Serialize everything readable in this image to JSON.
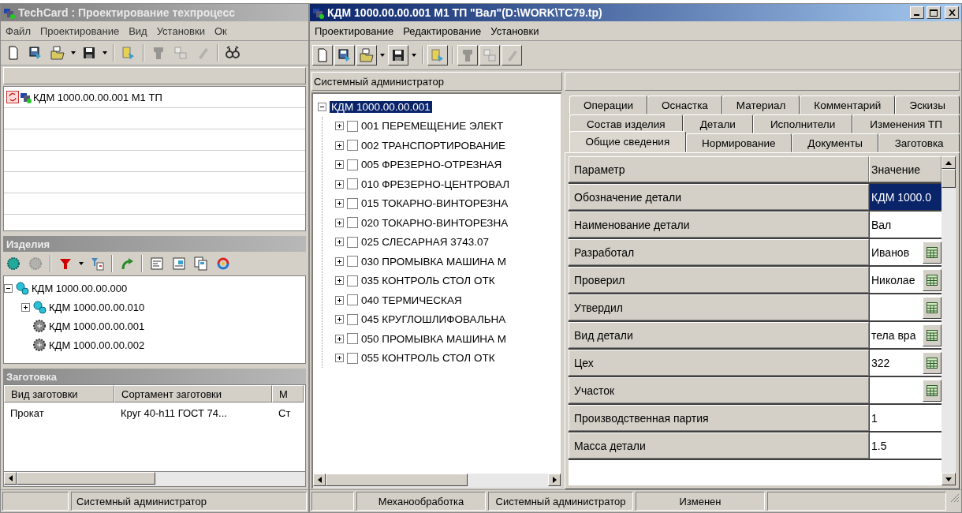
{
  "left_window": {
    "title": "TechCard : Проектирование техпроцесс",
    "menu": [
      "Файл",
      "Проектирование",
      "Вид",
      "Установки",
      "Ок"
    ],
    "documents": [
      {
        "label": "КДМ 1000.00.00.001 М1 ТП"
      }
    ],
    "products_panel": {
      "title": "Изделия",
      "tree": [
        {
          "label": "КДМ 1000.00.00.000",
          "kind": "assembly",
          "expanded": true,
          "children": [
            {
              "label": "КДМ 1000.00.00.010",
              "kind": "assembly",
              "expanded": false
            },
            {
              "label": "КДМ 1000.00.00.001",
              "kind": "part"
            },
            {
              "label": "КДМ 1000.00.00.002",
              "kind": "part"
            }
          ]
        }
      ]
    },
    "blank_panel": {
      "title": "Заготовка",
      "columns": [
        "Вид заготовки",
        "Сортамент заготовки",
        "М"
      ],
      "rows": [
        [
          "Прокат",
          "Круг  40-h11 ГОСТ 74...",
          "Ст"
        ]
      ]
    },
    "status_bar": [
      "Системный администратор"
    ]
  },
  "main_window": {
    "title": "КДМ 1000.00.00.001 М1 ТП \"Вал\"(D:\\WORK\\TC79.tp)",
    "menu": [
      "Проектирование",
      "Редактирование",
      "Установки"
    ],
    "user_field": "Системный администратор",
    "tree": {
      "label": "КДМ 1000.00.00.001",
      "expanded": true,
      "selected": true,
      "children": [
        {
          "label": "001  ПЕРЕМЕЩЕНИЕ   ЭЛЕКТ",
          "checked": false,
          "expanded": false
        },
        {
          "label": "002  ТРАНСПОРТИРОВАНИЕ",
          "checked": false,
          "expanded": false
        },
        {
          "label": "005  ФРЕЗЕРНО-ОТРЕЗНАЯ",
          "checked": false,
          "expanded": false
        },
        {
          "label": "010  ФРЕЗЕРНО-ЦЕНТРОВАЛ",
          "checked": false,
          "expanded": false
        },
        {
          "label": "015  ТОКАРНО-ВИНТОРЕЗНА",
          "checked": false,
          "expanded": false
        },
        {
          "label": "020  ТОКАРНО-ВИНТОРЕЗНА",
          "checked": false,
          "expanded": false
        },
        {
          "label": "025  СЛЕСАРНАЯ   3743.07",
          "checked": false,
          "expanded": false
        },
        {
          "label": "030  ПРОМЫВКА   МАШИНА М",
          "checked": false,
          "expanded": false
        },
        {
          "label": "035  КОНТРОЛЬ   СТОЛ ОТК",
          "checked": false,
          "expanded": false
        },
        {
          "label": "040  ТЕРМИЧЕСКАЯ",
          "checked": false,
          "expanded": false
        },
        {
          "label": "045  КРУГЛОШЛИФОВАЛЬНА",
          "checked": false,
          "expanded": false
        },
        {
          "label": "050  ПРОМЫВКА   МАШИНА М",
          "checked": false,
          "expanded": false
        },
        {
          "label": "055  КОНТРОЛЬ   СТОЛ ОТК",
          "checked": false,
          "expanded": false
        }
      ]
    },
    "tabs": [
      [
        {
          "label": "Операции",
          "selected": false
        },
        {
          "label": "Оснастка",
          "selected": false
        },
        {
          "label": "Материал",
          "selected": false
        },
        {
          "label": "Комментарий",
          "selected": false
        },
        {
          "label": "Эскизы",
          "selected": false
        }
      ],
      [
        {
          "label": "Состав изделия",
          "selected": false
        },
        {
          "label": "Детали",
          "selected": false
        },
        {
          "label": "Исполнители",
          "selected": false
        },
        {
          "label": "Изменения ТП",
          "selected": false
        }
      ],
      [
        {
          "label": "Общие сведения",
          "selected": true
        },
        {
          "label": "Нормирование",
          "selected": false
        },
        {
          "label": "Документы",
          "selected": false
        },
        {
          "label": "Заготовка",
          "selected": false
        }
      ]
    ],
    "properties": {
      "columns": [
        "Параметр",
        "Значение"
      ],
      "rows": [
        {
          "name": "Обозначение детали",
          "value": "КДМ 1000.0",
          "picker": false,
          "selected": true
        },
        {
          "name": "Наименование детали",
          "value": "Вал",
          "picker": false,
          "selected": false
        },
        {
          "name": "Разработал",
          "value": "Иванов",
          "picker": true,
          "selected": false
        },
        {
          "name": "Проверил",
          "value": "Николае",
          "picker": true,
          "selected": false
        },
        {
          "name": "Утвердил",
          "picker": true,
          "selected": false
        },
        {
          "name": "Вид детали",
          "value": "тела вра",
          "picker": true,
          "selected": false
        },
        {
          "name": "Цех",
          "value": "322",
          "picker": true,
          "selected": false
        },
        {
          "name": "Участок",
          "picker": true,
          "selected": false
        },
        {
          "name": "Производственная партия",
          "value": "1",
          "picker": false,
          "selected": false
        },
        {
          "name": "Масса детали",
          "value": "1.5",
          "picker": false,
          "selected": false
        }
      ]
    },
    "status_bar": [
      "Механообработка",
      "Системный администратор",
      "Изменен"
    ]
  }
}
